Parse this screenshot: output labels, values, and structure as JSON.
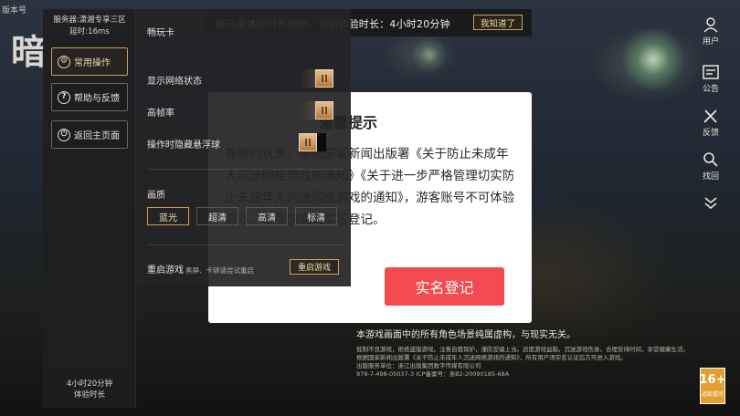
{
  "background": {
    "game_title_fragment": "版本号",
    "big_char": "暗"
  },
  "left_panel": {
    "server": "服务器:潇湘专享三区",
    "latency": "延时:16ms",
    "nav": [
      {
        "label": "常用操作",
        "icon": "gear-icon",
        "active": true
      },
      {
        "label": "帮助与反馈",
        "icon": "question-icon",
        "active": false
      },
      {
        "label": "返回主页面",
        "icon": "power-icon",
        "active": false
      }
    ],
    "play_time_value": "4小时20分钟",
    "play_time_label": "体验时长"
  },
  "settings": {
    "card_label": "畅玩卡",
    "toggles": [
      {
        "label": "显示网络状态",
        "on": true
      },
      {
        "label": "高帧率",
        "on": true
      },
      {
        "label": "操作时隐藏悬浮球",
        "on": false
      }
    ],
    "quality_label": "画质",
    "quality_options": [
      {
        "label": "蓝光",
        "active": true
      },
      {
        "label": "超清",
        "active": false
      },
      {
        "label": "高清",
        "active": false
      },
      {
        "label": "标清",
        "active": false
      }
    ],
    "restart_label": "重启游戏",
    "restart_hint": "黑屏、卡顿请尝试重启",
    "restart_button": "重启游戏"
  },
  "notice": {
    "text": "新玩家体验时长到账，当前体验时长：4小时20分钟",
    "button": "我知道了"
  },
  "dialog": {
    "title": "温馨提示",
    "body": "尊敬的玩家，根据国家新闻出版署《关于防止未成年人沉迷网络游戏的通知》《关于进一步严格管理切实防止未成年人沉迷网络游戏的通知》，游客账号不可体验游戏，请尽快完成实名登记。",
    "button": "实名登记"
  },
  "disclaimer": {
    "line1": "本游戏画面中的所有角色场景纯属虚构，与现实无关。",
    "line2": "抵制不良游戏，拒绝盗版游戏。注意自我保护，谨防受骗上当。适度游戏益脑，沉迷游戏伤身。合理安排时间，享受健康生活。",
    "line3": "根据国家新闻出版署《关于防止未成年人沉迷网络游戏的通知》，所有用户须实名认证后方可进入游戏。",
    "line4": "出版服务单位：浙江出版集团数字传媒有限公司",
    "line5": "978-7-498-05037-3    ICP备案号：浙B2-20090185-68A"
  },
  "sidebar": [
    {
      "label": "用户",
      "icon": "user-icon"
    },
    {
      "label": "公告",
      "icon": "announcement-icon"
    },
    {
      "label": "反馈",
      "icon": "tools-icon"
    },
    {
      "label": "找回",
      "icon": "search-icon"
    }
  ],
  "age_rating": {
    "num": "16+",
    "label": "适龄提示"
  }
}
